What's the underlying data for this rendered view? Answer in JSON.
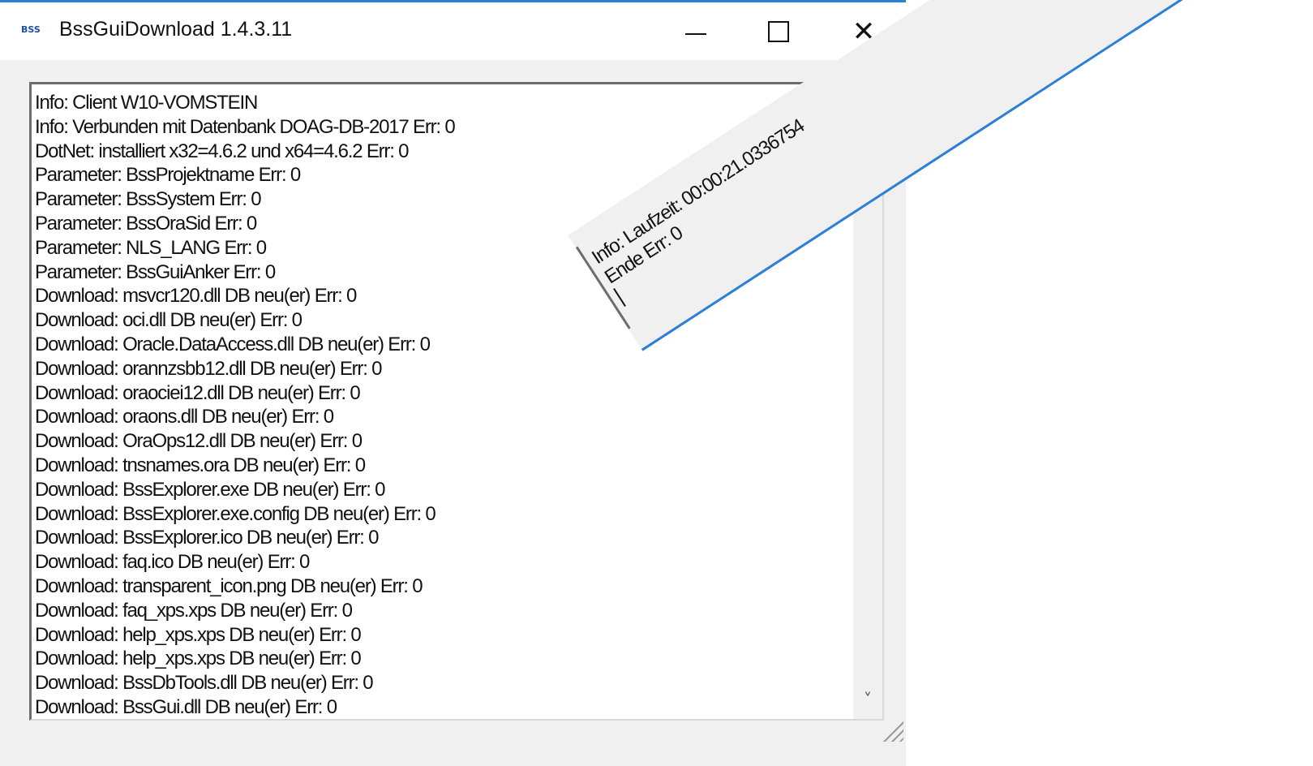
{
  "window": {
    "icon_text": "BSS",
    "title": "BssGuiDownload 1.4.3.11",
    "controls": {
      "minimize": "minimize",
      "maximize": "maximize",
      "close": "✕"
    }
  },
  "log_lines": [
    "Info: Client W10-VOMSTEIN",
    "Info: Verbunden mit Datenbank DOAG-DB-2017 Err: 0",
    "DotNet: installiert x32=4.6.2 und x64=4.6.2 Err: 0",
    "Parameter: BssProjektname Err: 0",
    "Parameter: BssSystem Err: 0",
    "Parameter: BssOraSid Err: 0",
    "Parameter: NLS_LANG Err: 0",
    "Parameter: BssGuiAnker Err: 0",
    "Download: msvcr120.dll DB neu(er) Err: 0",
    "Download: oci.dll DB neu(er) Err: 0",
    "Download: Oracle.DataAccess.dll DB neu(er) Err: 0",
    "Download: orannzsbb12.dll DB neu(er) Err: 0",
    "Download: oraociei12.dll DB neu(er) Err: 0",
    "Download: oraons.dll DB neu(er) Err: 0",
    "Download: OraOps12.dll DB neu(er) Err: 0",
    "Download: tnsnames.ora DB neu(er) Err: 0",
    "Download: BssExplorer.exe DB neu(er) Err: 0",
    "Download: BssExplorer.exe.config DB neu(er) Err: 0",
    "Download: BssExplorer.ico DB neu(er) Err: 0",
    "Download: faq.ico DB neu(er) Err: 0",
    "Download: transparent_icon.png DB neu(er) Err: 0",
    "Download: faq_xps.xps DB neu(er) Err: 0",
    "Download: help_xps.xps DB neu(er) Err: 0",
    "Download: help_xps.xps DB neu(er) Err: 0",
    "Download: BssDbTools.dll DB neu(er) Err: 0",
    "Download: BssGui.dll DB neu(er) Err: 0"
  ],
  "fragment_lines": [
    "Info: Laufzeit: 00:00:21.0336754",
    "Ende Err: 0"
  ],
  "icons": {
    "scroll_up": "˄",
    "scroll_down": "˅"
  },
  "colors": {
    "accent": "#2b7fd6",
    "window_bg": "#f0f0f0"
  }
}
